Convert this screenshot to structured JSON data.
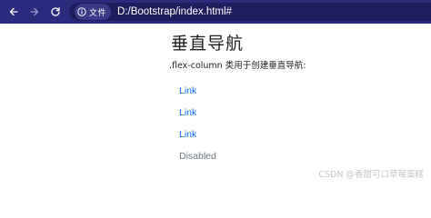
{
  "browser": {
    "site_info_label": "文件",
    "url": "D:/Bootstrap/index.html#"
  },
  "page": {
    "title": "垂直导航",
    "subtitle": ".flex-column 类用于创建垂直导航:",
    "nav": [
      {
        "label": "Link",
        "state": "active"
      },
      {
        "label": "Link",
        "state": "active"
      },
      {
        "label": "Link",
        "state": "active"
      },
      {
        "label": "Disabled",
        "state": "disabled"
      }
    ]
  },
  "watermark": "CSDN @香甜可口草莓蛋糕",
  "colors": {
    "toolbar": "#2c2c7e",
    "link": "#0d6efd",
    "disabled": "#6c757d"
  }
}
